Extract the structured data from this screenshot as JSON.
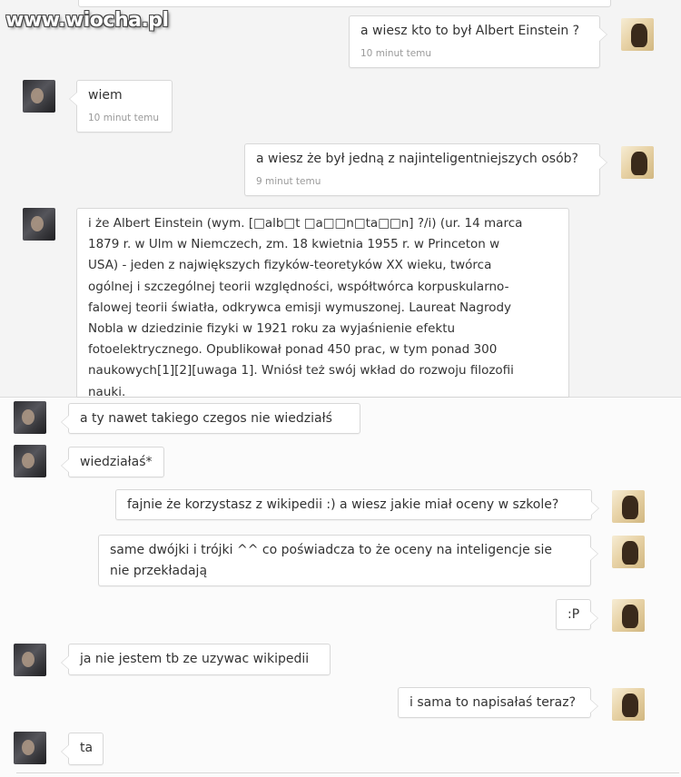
{
  "watermark": "www.wiocha.pl",
  "messages": [
    {
      "text": "a wiesz kto to był Albert Einstein ?",
      "time": "10 minut temu"
    },
    {
      "text": "wiem",
      "time": "10 minut temu"
    },
    {
      "text": "a wiesz że był jedną z najinteligentniejszych osób?",
      "time": "9 minut temu"
    },
    {
      "lines": [
        "i że Albert Einstein (wym. [□alb□t □a□□n□ta□□n] ?/i) (ur. 14 marca",
        "1879 r. w Ulm w Niemczech, zm. 18 kwietnia 1955 r. w Princeton w",
        "USA) - jeden z największych fizyków-teoretyków XX wieku, twórca",
        "ogólnej i szczególnej teorii względności, współtwórca korpuskularno-",
        "falowej teorii światła, odkrywca emisji wymuszonej. Laureat Nagrody",
        "Nobla w dziedzinie fizyki w 1921 roku za wyjaśnienie efektu",
        "fotoelektrycznego. Opublikował ponad 450 prac, w tym ponad 300",
        "naukowych[1][2][uwaga 1]. Wniósł też swój wkład do rozwoju filozofii",
        "nauki."
      ]
    },
    {
      "text": "a ty nawet takiego czegos nie wiedziałś"
    },
    {
      "text": "wiedziałaś*"
    },
    {
      "text": "fajnie że korzystasz z wikipedii :) a wiesz jakie miał oceny w szkole?"
    },
    {
      "lines": [
        "same dwójki i trójki ^^ co poświadcza to że oceny na inteligencje sie",
        "nie przekładają"
      ]
    },
    {
      "text": ":P"
    },
    {
      "text": "ja nie jestem tb ze uzywac wikipedii"
    },
    {
      "text": "i sama to napisałaś teraz?"
    },
    {
      "text": "ta"
    }
  ]
}
